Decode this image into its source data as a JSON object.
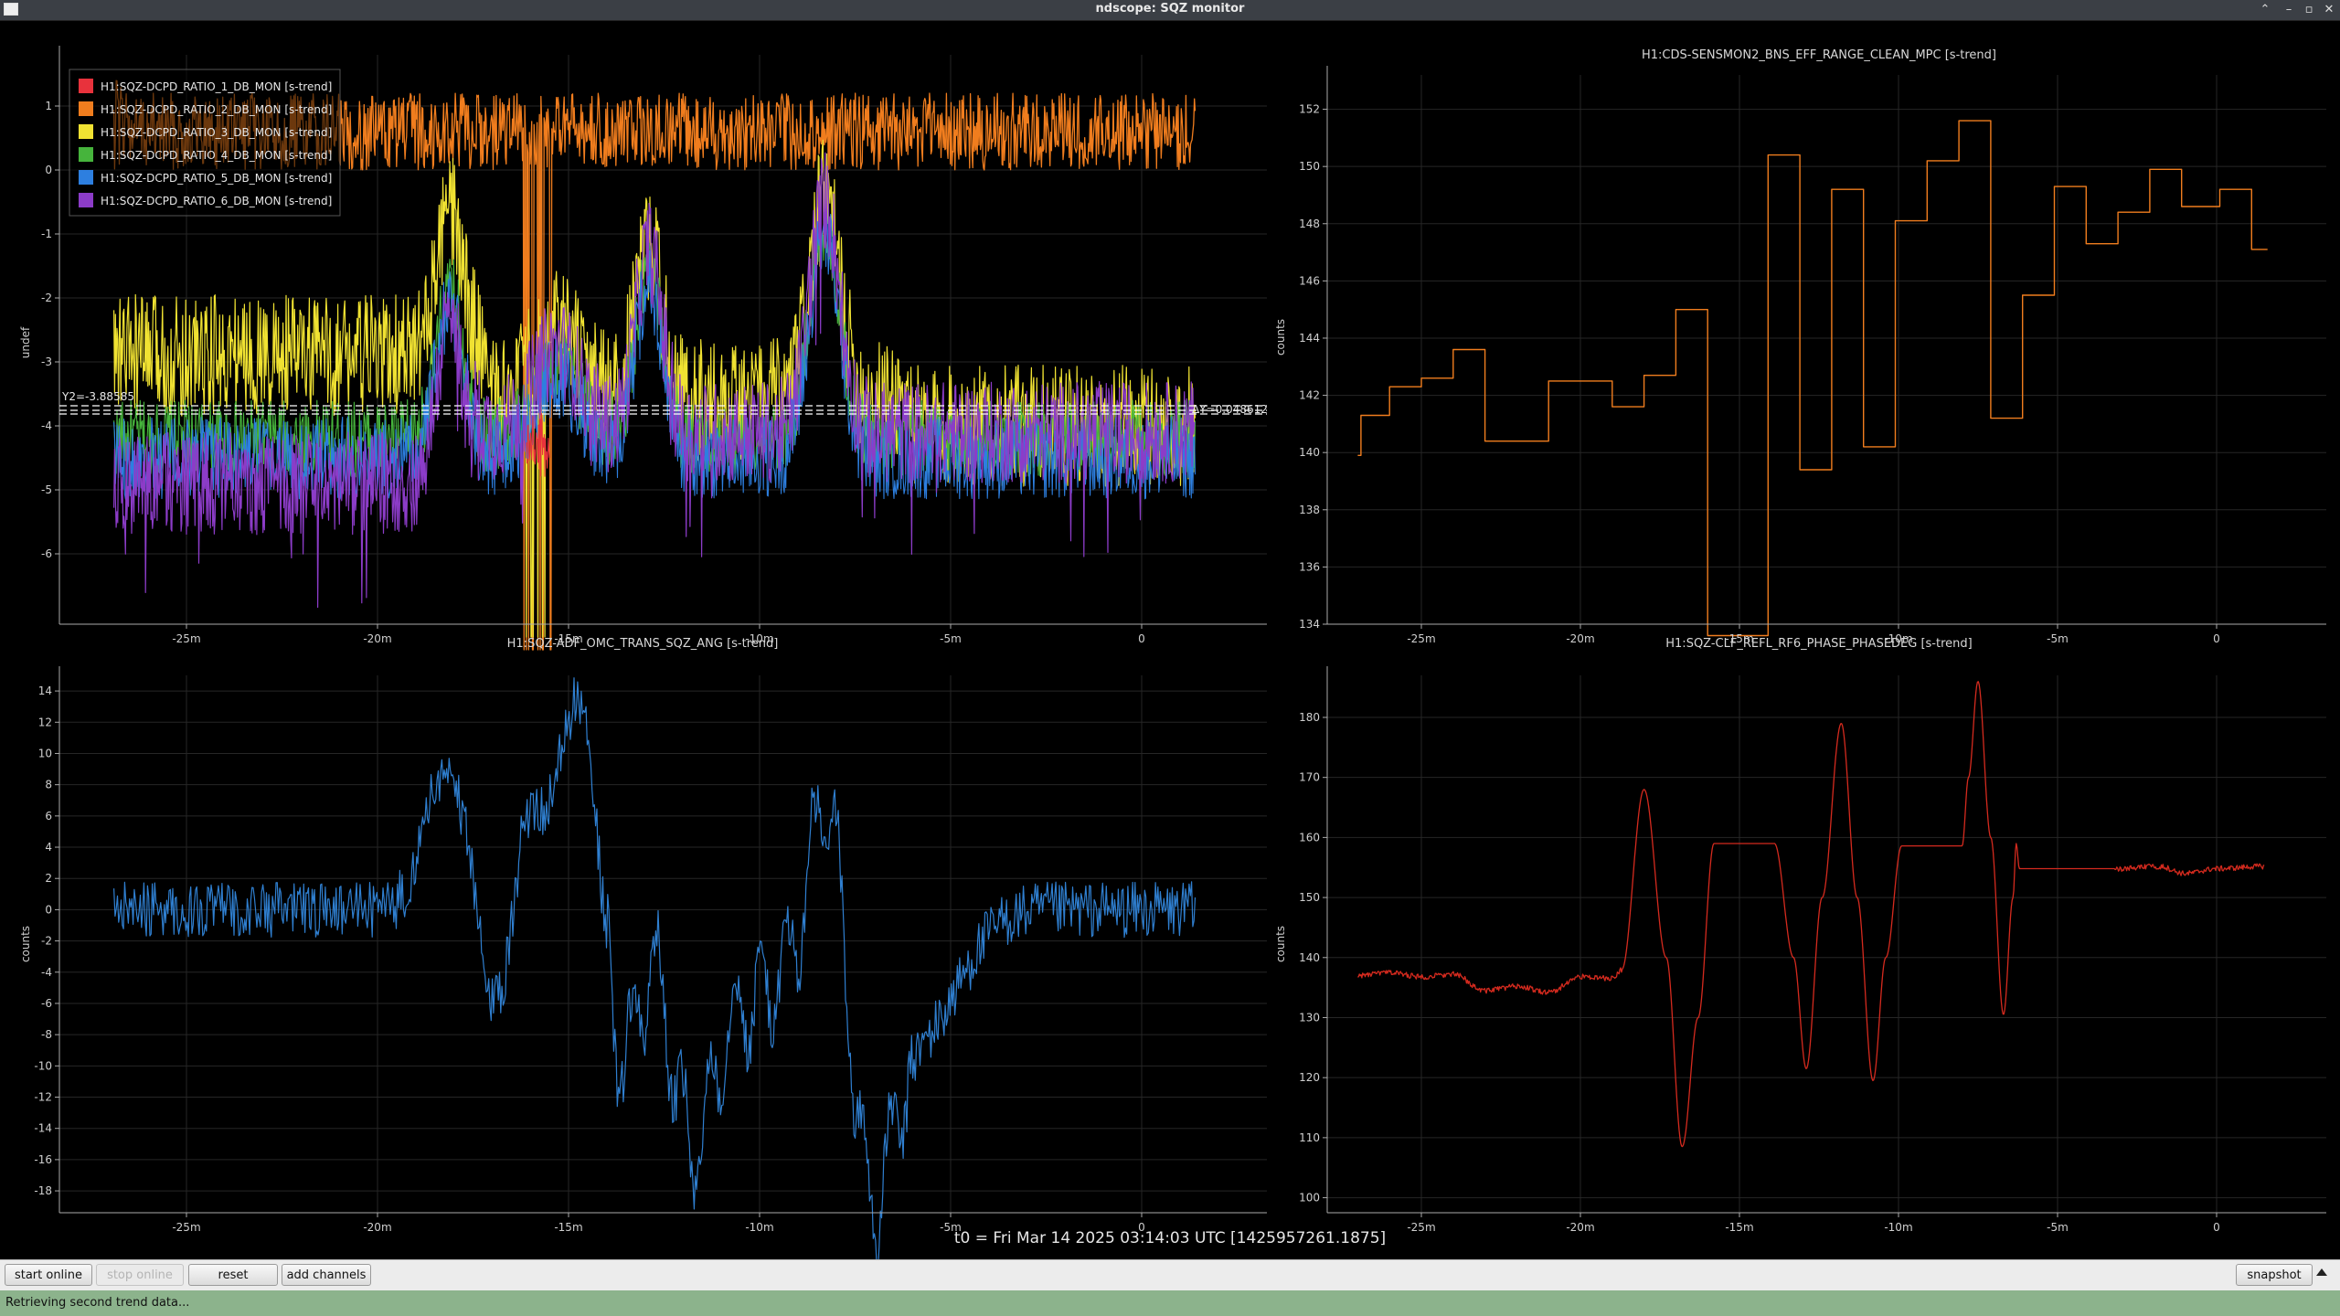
{
  "window": {
    "title": "ndscope: SQZ monitor"
  },
  "plots": {
    "top_left": {
      "ylabel": "undef",
      "yticks": [
        "1",
        "0",
        "-1",
        "-2",
        "-3",
        "-4",
        "-5",
        "-6"
      ],
      "xticks": [
        "-25m",
        "-20m",
        "-15m",
        "-10m",
        "-5m",
        "0"
      ],
      "cursor_label": "Y2=-3.88585",
      "delta_label": "ΔY=0.048612",
      "legend": [
        {
          "name": "H1:SQZ-DCPD_RATIO_1_DB_MON [s-trend]",
          "color": "#e8323c"
        },
        {
          "name": "H1:SQZ-DCPD_RATIO_2_DB_MON [s-trend]",
          "color": "#f07d1e"
        },
        {
          "name": "H1:SQZ-DCPD_RATIO_3_DB_MON [s-trend]",
          "color": "#f0e232"
        },
        {
          "name": "H1:SQZ-DCPD_RATIO_4_DB_MON [s-trend]",
          "color": "#46b43c"
        },
        {
          "name": "H1:SQZ-DCPD_RATIO_5_DB_MON [s-trend]",
          "color": "#2d7fe0"
        },
        {
          "name": "H1:SQZ-DCPD_RATIO_6_DB_MON [s-trend]",
          "color": "#8c3cc8"
        }
      ]
    },
    "top_right": {
      "title": "H1:CDS-SENSMON2_BNS_EFF_RANGE_CLEAN_MPC [s-trend]",
      "ylabel": "counts",
      "yticks": [
        "152",
        "150",
        "148",
        "146",
        "144",
        "142",
        "140",
        "138",
        "136",
        "134"
      ],
      "xticks": [
        "-25m",
        "-20m",
        "-15m",
        "-10m",
        "-5m",
        "0"
      ],
      "color": "#f07d1e"
    },
    "bottom_left": {
      "title": "H1:SQZ-ADF_OMC_TRANS_SQZ_ANG [s-trend]",
      "ylabel": "counts",
      "yticks": [
        "14",
        "12",
        "10",
        "8",
        "6",
        "4",
        "2",
        "0",
        "-2",
        "-4",
        "-6",
        "-8",
        "-10",
        "-12",
        "-14",
        "-16",
        "-18"
      ],
      "xticks": [
        "-25m",
        "-20m",
        "-15m",
        "-10m",
        "-5m",
        "0"
      ],
      "color": "#2f7fd0"
    },
    "bottom_right": {
      "title": "H1:SQZ-CLF_REFL_RF6_PHASE_PHASEDEG [s-trend]",
      "ylabel": "counts",
      "yticks": [
        "180",
        "170",
        "160",
        "150",
        "140",
        "130",
        "120",
        "110",
        "100"
      ],
      "xticks": [
        "-25m",
        "-20m",
        "-15m",
        "-10m",
        "-5m",
        "0"
      ],
      "color": "#d42a1e"
    }
  },
  "t0_label": "t0 = Fri Mar 14 2025 03:14:03 UTC [1425957261.1875]",
  "buttons": {
    "start_online": "start online",
    "stop_online": "stop online",
    "reset": "reset",
    "add_channels": "add channels",
    "snapshot": "snapshot"
  },
  "status": "Retrieving second trend data..."
}
